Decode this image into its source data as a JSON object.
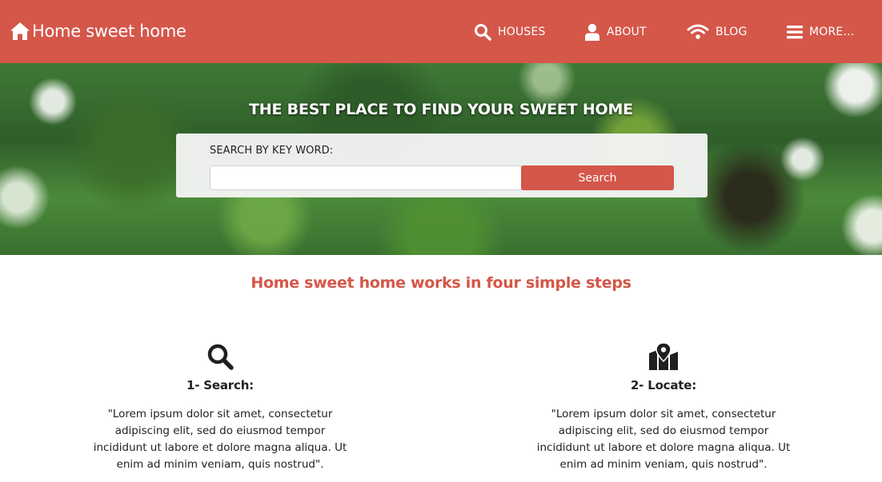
{
  "navbar": {
    "brand": {
      "label": "Home sweet home",
      "icon": "home-icon"
    },
    "items": [
      {
        "label": "HOUSES",
        "icon": "search-icon"
      },
      {
        "label": "ABOUT",
        "icon": "user-icon"
      },
      {
        "label": "BLOG",
        "icon": "wifi-icon"
      },
      {
        "label": "MORE...",
        "icon": "bars-icon"
      }
    ]
  },
  "hero": {
    "title": "THE BEST PLACE TO FIND YOUR SWEET HOME",
    "search": {
      "label": "SEARCH BY KEY WORD:",
      "value": "",
      "placeholder": "",
      "button_label": "Search"
    }
  },
  "steps": {
    "heading": "Home sweet home works in four simple steps",
    "items": [
      {
        "icon": "search-icon",
        "title": "1- Search:",
        "text": "\"Lorem ipsum dolor sit amet, consectetur adipiscing elit, sed do eiusmod tempor incididunt ut labore et dolore magna aliqua. Ut enim ad minim veniam, quis nostrud\"."
      },
      {
        "icon": "map-marker-icon",
        "title": "2- Locate:",
        "text": "\"Lorem ipsum dolor sit amet, consectetur adipiscing elit, sed do eiusmod tempor incididunt ut labore et dolore magna aliqua. Ut enim ad minim veniam, quis nostrud\"."
      }
    ]
  },
  "colors": {
    "brand": "#d4574a",
    "text": "#222222",
    "panel": "#f5f5f5"
  }
}
